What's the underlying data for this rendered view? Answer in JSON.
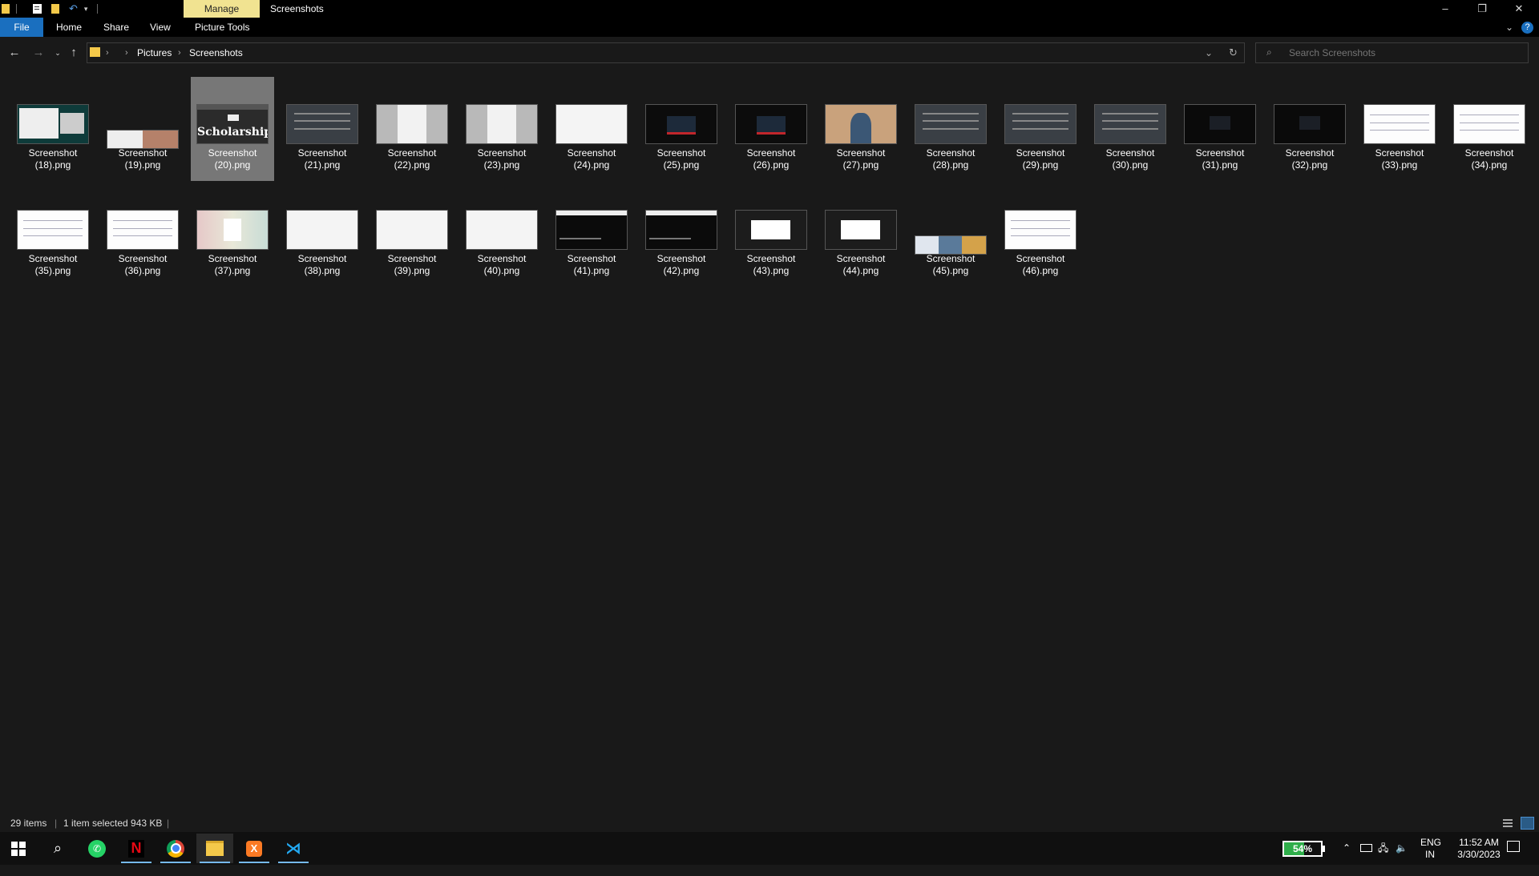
{
  "window": {
    "ribbon_context_tab": "Manage",
    "title": "Screenshots",
    "controls": [
      "–",
      "❐",
      "✕"
    ]
  },
  "ribbon": {
    "tabs": [
      "File",
      "Home",
      "Share",
      "View",
      "Picture Tools"
    ]
  },
  "address": {
    "crumbs": [
      "Pictures",
      "Screenshots"
    ],
    "search_placeholder": "Search Screenshots"
  },
  "files": [
    {
      "name": "Screenshot (18).png",
      "thumb": "dark-teal"
    },
    {
      "name": "Screenshot (19).png",
      "thumb": "white-photo"
    },
    {
      "name": "Screenshot (20).png",
      "thumb": "scholarship",
      "selected": true,
      "thumb_text": "Scholarship"
    },
    {
      "name": "Screenshot (21).png",
      "thumb": "grey-doc"
    },
    {
      "name": "Screenshot (22).png",
      "thumb": "light-form"
    },
    {
      "name": "Screenshot (23).png",
      "thumb": "light-form"
    },
    {
      "name": "Screenshot (24).png",
      "thumb": "white"
    },
    {
      "name": "Screenshot (25).png",
      "thumb": "dark-red"
    },
    {
      "name": "Screenshot (26).png",
      "thumb": "dark-red"
    },
    {
      "name": "Screenshot (27).png",
      "thumb": "photo"
    },
    {
      "name": "Screenshot (28).png",
      "thumb": "grey-doc"
    },
    {
      "name": "Screenshot (29).png",
      "thumb": "grey-doc"
    },
    {
      "name": "Screenshot (30).png",
      "thumb": "grey-doc"
    },
    {
      "name": "Screenshot (31).png",
      "thumb": "dark"
    },
    {
      "name": "Screenshot (32).png",
      "thumb": "dark"
    },
    {
      "name": "Screenshot (33).png",
      "thumb": "white-lines"
    },
    {
      "name": "Screenshot (34).png",
      "thumb": "white-lines"
    },
    {
      "name": "Screenshot (35).png",
      "thumb": "white-lines"
    },
    {
      "name": "Screenshot (36).png",
      "thumb": "white-lines"
    },
    {
      "name": "Screenshot (37).png",
      "thumb": "pastel"
    },
    {
      "name": "Screenshot (38).png",
      "thumb": "white"
    },
    {
      "name": "Screenshot (39).png",
      "thumb": "white"
    },
    {
      "name": "Screenshot (40).png",
      "thumb": "white"
    },
    {
      "name": "Screenshot (41).png",
      "thumb": "dark-code"
    },
    {
      "name": "Screenshot (42).png",
      "thumb": "dark-code"
    },
    {
      "name": "Screenshot (43).png",
      "thumb": "dark-dialog"
    },
    {
      "name": "Screenshot (44).png",
      "thumb": "dark-dialog"
    },
    {
      "name": "Screenshot (45).png",
      "thumb": "colorful"
    },
    {
      "name": "Screenshot (46).png",
      "thumb": "white-lines"
    }
  ],
  "status": {
    "count": "29 items",
    "selection": "1 item selected  943 KB"
  },
  "taskbar": {
    "apps": [
      "windows-start",
      "search",
      "whatsapp",
      "netflix",
      "chrome",
      "file-explorer",
      "xampp",
      "vscode"
    ],
    "battery": "54%",
    "lang_top": "ENG",
    "lang_bottom": "IN",
    "time": "11:52 AM",
    "date": "3/30/2023"
  },
  "colors": {
    "background": "#191919",
    "accent": "#1a6fbf",
    "manage_tab": "#f1e391",
    "selected_item": "#777777"
  }
}
